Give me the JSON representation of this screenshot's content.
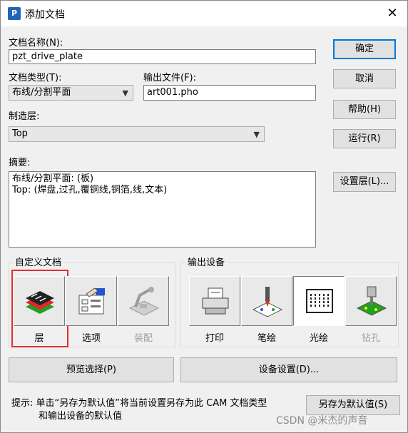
{
  "window": {
    "title": "添加文档",
    "close_symbol": "✕"
  },
  "doc_name": {
    "label": "文档名称(N):",
    "value": "pzt_drive_plate"
  },
  "doc_type": {
    "label": "文档类型(T):",
    "value": "布线/分割平面"
  },
  "output_file": {
    "label": "输出文件(F):",
    "value": "art001.pho"
  },
  "layer": {
    "label": "制造层:",
    "value": "Top"
  },
  "summary": {
    "label": "摘要:",
    "line1": "布线/分割平面: (板)",
    "line2": "Top: (焊盘,过孔,覆铜线,铜箔,线,文本)"
  },
  "buttons": {
    "ok": "确定",
    "cancel": "取消",
    "help": "帮助(H)",
    "run": "运行(R)",
    "layers": "设置层(L)...",
    "preview": "预览选择(P)",
    "device_setup": "设备设置(D)...",
    "save_default": "另存为默认值(S)"
  },
  "custom_doc": {
    "title": "自定义文档",
    "items": [
      "层",
      "选项",
      "装配"
    ]
  },
  "output_device": {
    "title": "输出设备",
    "items": [
      "打印",
      "笔绘",
      "光绘",
      "钻孔"
    ]
  },
  "hint": {
    "line1": "提示: 单击“另存为默认值”将当前设置另存为此 CAM 文档类型",
    "line2": "和输出设备的默认值"
  },
  "watermark": "CSDN @米杰的声音",
  "colors": {
    "accent": "#0078d7",
    "highlight": "#e03030"
  }
}
